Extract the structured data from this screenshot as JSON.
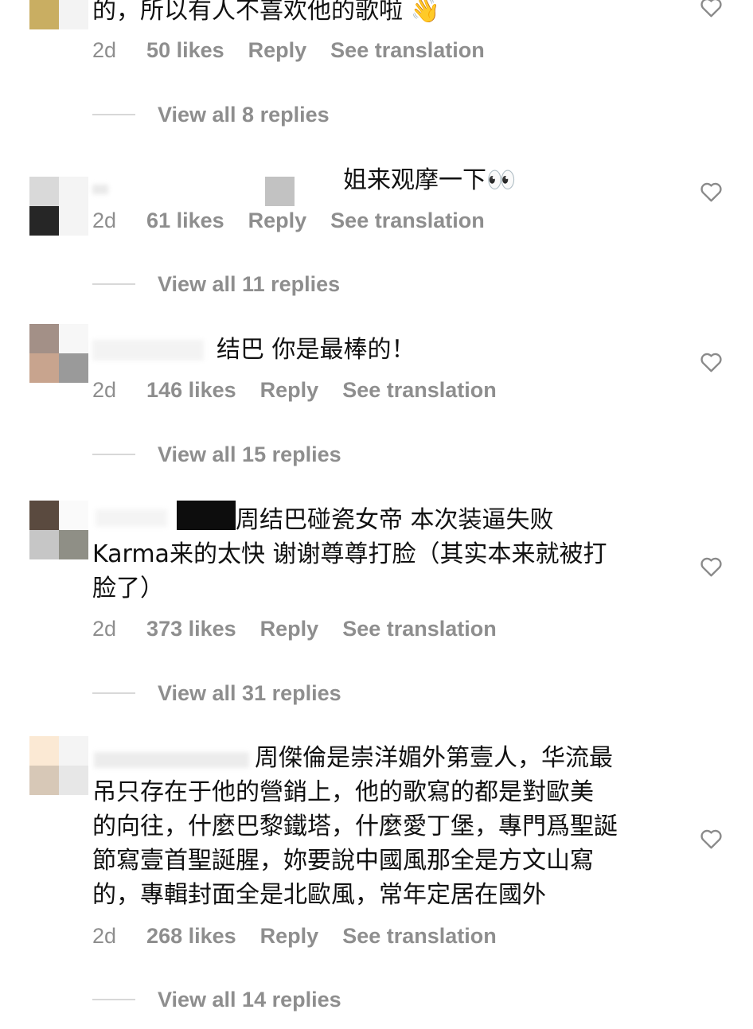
{
  "comments": [
    {
      "text": "的，所以有人不喜欢他的歌啦 👋",
      "age": "2d",
      "likes": "50 likes",
      "reply": "Reply",
      "translate": "See translation",
      "view_replies": "View all 8 replies"
    },
    {
      "text": "姐来观摩一下👀",
      "age": "2d",
      "likes": "61 likes",
      "reply": "Reply",
      "translate": "See translation",
      "view_replies": "View all 11 replies"
    },
    {
      "text": "结巴 你是最棒的！",
      "age": "2d",
      "likes": "146 likes",
      "reply": "Reply",
      "translate": "See translation",
      "view_replies": "View all 15 replies"
    },
    {
      "text": "周结巴碰瓷女帝 本次装逼失败\nKarma来的太快 谢谢尊尊打脸（其实本来就被打\n脸了）",
      "age": "2d",
      "likes": "373 likes",
      "reply": "Reply",
      "translate": "See translation",
      "view_replies": "View all 31 replies"
    },
    {
      "text": "周傑倫是崇洋媚外第壹人，华流最\n吊只存在于他的營銷上，他的歌寫的都是對歐美\n的向往，什麼巴黎鐵塔，什麼愛丁堡，專門爲聖誕\n節寫壹首聖誕腥，妳要說中國風那全是方文山寫\n的，專輯封面全是北歐風，常年定居在國外",
      "age": "2d",
      "likes": "268 likes",
      "reply": "Reply",
      "translate": "See translation",
      "view_replies": "View all 14 replies"
    }
  ],
  "icons": {
    "like": "heart-outline-icon",
    "avatar": "pixelated-avatar"
  },
  "colors": {
    "text": "#111111",
    "meta": "#8e8e8e",
    "divider": "#d8d8d8"
  }
}
